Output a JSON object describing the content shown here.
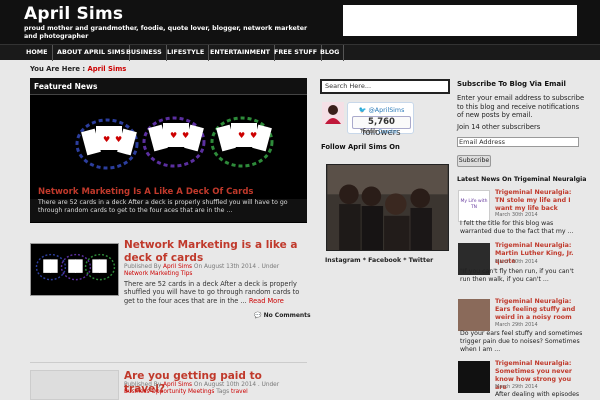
{
  "site": {
    "title": "April Sims",
    "tagline": "proud mother and grandmother, foodie, quote lover, blogger, network marketer and photographer"
  },
  "nav": [
    "HOME",
    "ABOUT APRIL SIMS",
    "BUSINESS",
    "LIFESTYLE",
    "ENTERTAINMENT",
    "FREE STUFF",
    "BLOG"
  ],
  "breadcrumb": {
    "label": "You Are Here :",
    "current": "April Sims"
  },
  "featured": {
    "heading": "Featured News",
    "title": "Network Marketing Is A Like A Deck Of Cards",
    "excerpt": "There are 52 cards in a deck   After a deck is properly shuffled you will have to go through random cards to get to the four aces that are in the ..."
  },
  "posts": [
    {
      "title": "Network Marketing is a like a deck of cards",
      "meta_prefix": "Published By",
      "author": "April Sims",
      "date_prefix": "On August 13th 2014 . Under",
      "category": "Network Marketing Tips",
      "excerpt": "There are 52 cards in a deck   After a deck is properly shuffled you will have to go through random cards to get to the four aces that are in the ...",
      "read_more": "Read More",
      "comments": "No Comments"
    },
    {
      "title": "Are you getting paid to travel?",
      "meta_prefix": "Published By",
      "author": "April Sims",
      "date_prefix": "On August 10th 2014 . Under",
      "category": "Business Opportunity Meetings",
      "tags_label": "Tags",
      "tags": "travel"
    }
  ],
  "sidebar_mid": {
    "search_placeholder": "Search Here...",
    "twitter_handle": "@AprilSims",
    "followers_count": "5,760",
    "followers_label": "followers",
    "counter_prefix": "Twitter",
    "counter_suffix": "Counter",
    "follow_heading": "Follow April Sims On",
    "social_line": "Instagram * Facebook * Twitter"
  },
  "sidebar_right": {
    "subscribe_heading": "Subscribe To Blog Via Email",
    "subscribe_text": "Enter your email address to subscribe to this blog and receive notifications of new posts by email.",
    "subscribers": "Join 14 other subscribers",
    "email_placeholder": "Email Address",
    "subscribe_button": "Subscribe",
    "news_heading": "Latest News On Trigeminal Neuralgia",
    "news": [
      {
        "title": "Trigeminal Neuralgia: TN stole my life and I want my life back",
        "date": "March 30th 2014",
        "excerpt": "I felt the title for this blog was warranted due to the fact that my ...",
        "thumb_text": "My Life with TN"
      },
      {
        "title": "Trigeminal Neuralgia: Martin Luther King, Jr. quote",
        "date": "March 30th 2014",
        "excerpt": "\"If you can't fly then run, if you can't run then walk, if you can't ..."
      },
      {
        "title": "Trigeminal Neuralgia: Ears feeling stuffy and weird in a noisy room",
        "date": "March 29th 2014",
        "excerpt": "Do your ears feel stuffy and sometimes trigger pain due to noises? Sometimes when I am ..."
      },
      {
        "title": "Trigeminal Neuralgia: Sometimes you never know how strong you are",
        "date": "March 29th 2014",
        "excerpt": "After dealing with episodes"
      }
    ]
  },
  "colors": {
    "accent": "#c0392b",
    "header_bg": "#111111",
    "page_bg": "#e8e8e8"
  }
}
